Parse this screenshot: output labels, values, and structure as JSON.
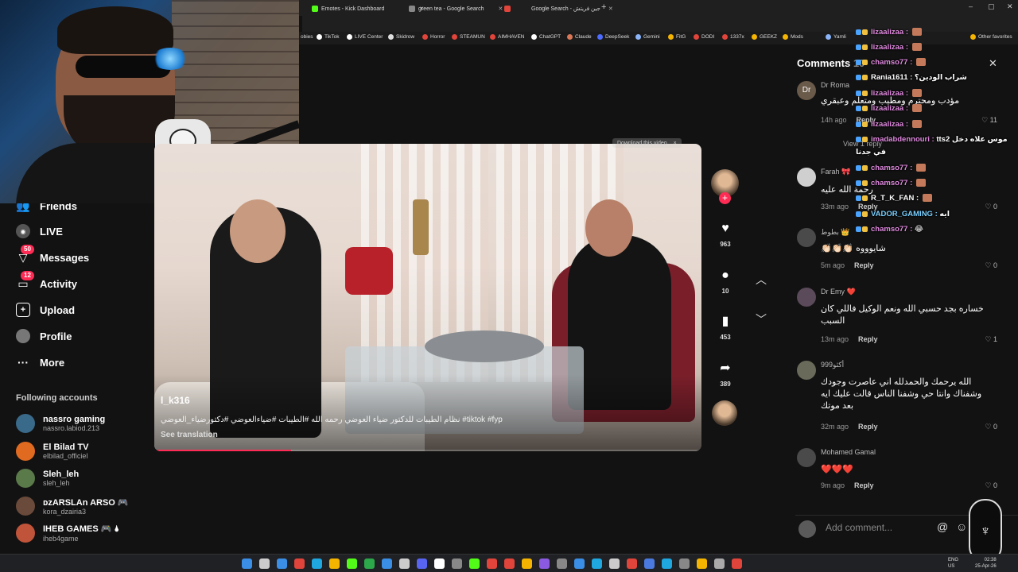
{
  "browser": {
    "tabs": [
      {
        "title": "Emotes - Kick Dashboard",
        "color": "#53fc18"
      },
      {
        "title": "green tea - Google Search",
        "color": "#888888"
      },
      {
        "title": "",
        "color": "#e0443a"
      },
      {
        "title": "Google Search - جين فريتش",
        "color": "#888888"
      }
    ],
    "new_tab": "+",
    "bookmarks": [
      {
        "label": "obies",
        "color": "#777777"
      },
      {
        "label": "TikTok",
        "color": "#ffffff"
      },
      {
        "label": "LIVE Center",
        "color": "#ffffff"
      },
      {
        "label": "Skidrow",
        "color": "#ffffff"
      },
      {
        "label": "Horror",
        "color": "#e0443a"
      },
      {
        "label": "STEAMUN",
        "color": "#e0443a"
      },
      {
        "label": "AIMHAVEN",
        "color": "#e0443a"
      },
      {
        "label": "ChatGPT",
        "color": "#ffffff"
      },
      {
        "label": "Claude",
        "color": "#d97757"
      },
      {
        "label": "DeepSeek",
        "color": "#4d6bfe"
      },
      {
        "label": "Gemini",
        "color": "#8ab4f8"
      },
      {
        "label": "FitG",
        "color": "#f4b400"
      },
      {
        "label": "DODI",
        "color": "#e0443a"
      },
      {
        "label": "1337x",
        "color": "#e0443a"
      },
      {
        "label": "GEEKZ",
        "color": "#f4b400"
      },
      {
        "label": "Mods",
        "color": "#f4b400"
      },
      {
        "label": "Yamli",
        "color": "#8ab4f8"
      },
      {
        "label": "Other favorites",
        "color": "#f4b400"
      }
    ]
  },
  "nav": {
    "items": [
      {
        "label": "Friends",
        "icon": "friends-icon",
        "badge": ""
      },
      {
        "label": "LIVE",
        "icon": "live-icon",
        "badge": ""
      },
      {
        "label": "Messages",
        "icon": "messages-icon",
        "badge": "50"
      },
      {
        "label": "Activity",
        "icon": "activity-icon",
        "badge": "12"
      },
      {
        "label": "Upload",
        "icon": "upload-icon",
        "badge": ""
      },
      {
        "label": "Profile",
        "icon": "profile-icon",
        "badge": ""
      },
      {
        "label": "More",
        "icon": "more-icon",
        "badge": ""
      }
    ],
    "following_title": "Following accounts",
    "accounts": [
      {
        "name": "nassro gaming",
        "handle": "nassro.labiod.213",
        "color": "#3a6a8a"
      },
      {
        "name": "El Bilad TV",
        "handle": "elbilad_officiel",
        "color": "#e06a20"
      },
      {
        "name": "Sleh_leh",
        "handle": "sleh_leh",
        "color": "#5a7a4a"
      },
      {
        "name": "ᴅᴢARSLAn ARSO 🎮",
        "handle": "kora_dzairia3",
        "color": "#6a4a3a"
      },
      {
        "name": "IHEB GAMES 🎮 🌢",
        "handle": "iheb4game",
        "color": "#c0543a"
      }
    ]
  },
  "video": {
    "username": "l_k316",
    "caption": "نظام الطيبات للدكتور ضياء العوضي رحمه الله #الطيبات #ضياءالعوضي #دكتورضياء_العوضي #tiktok #fyp",
    "see_translation": "See translation",
    "progress": 0.25,
    "download_label": "Download this video",
    "download_close": "×",
    "likes": "963",
    "comments": "10",
    "saves": "453",
    "shares": "389",
    "follow_plus": "+"
  },
  "comments_panel": {
    "title": "Comments",
    "count": "10",
    "close": "✕",
    "view_reply": "View 1 reply",
    "add_placeholder": "Add comment...",
    "comments": [
      {
        "user": "Dr Roma",
        "text": "مؤدب ومحترم ومطيب ومتعلم وعبقري",
        "time": "14h ago",
        "reply": "Reply",
        "likes": "11",
        "avatar_text": "Dr",
        "color": "#6a5a4a"
      },
      {
        "user": "Farah 🎀",
        "text": "رحمة الله عليه",
        "time": "33m ago",
        "reply": "Reply",
        "likes": "0",
        "avatar_text": "",
        "color": "#cfcfcf"
      },
      {
        "user": "بطوط 👑",
        "text": "شايوووه 👏🏻👏🏻👏🏻",
        "time": "5m ago",
        "reply": "Reply",
        "likes": "0",
        "avatar_text": "",
        "color": "#4a4a4a"
      },
      {
        "user": "Dr Emy ❤️",
        "text": "خساره بجد حسبي الله ونعم الوكيل فاللي كان السبب",
        "time": "13m ago",
        "reply": "Reply",
        "likes": "1",
        "avatar_text": "",
        "color": "#5a4a5a"
      },
      {
        "user": "999أكثو",
        "text": "الله يرحمك والحمدلله اني عاصرت وجودك وشفناك وانتا حي وشفنا الناس قالت عليك ايه بعد موتك",
        "time": "32m ago",
        "reply": "Reply",
        "likes": "0",
        "avatar_text": "",
        "color": "#6a6a5a"
      },
      {
        "user": "Mohamed Gamal",
        "text": "❤️❤️❤️",
        "time": "9m ago",
        "reply": "Reply",
        "likes": "0",
        "avatar_text": "",
        "color": "#4a4a4a"
      }
    ]
  },
  "stream_chat": [
    {
      "user": "lizaalizaa",
      "color": "#e08adf",
      "msg": ""
    },
    {
      "user": "lizaalizaa",
      "color": "#e08adf",
      "msg": ""
    },
    {
      "user": "chamso77",
      "color": "#e08adf",
      "msg": ""
    },
    {
      "user": "Rania1611",
      "color": "#ffffff",
      "msg": "شراب الودين؟"
    },
    {
      "user": "lizaalizaa",
      "color": "#e08adf",
      "msg": ""
    },
    {
      "user": "lizaalizaa",
      "color": "#e08adf",
      "msg": ""
    },
    {
      "user": "lizaalizaa",
      "color": "#e08adf",
      "msg": ""
    },
    {
      "user": "imadabdennouri",
      "color": "#e08adf",
      "msg": "tts2 موس علاه دخل"
    },
    {
      "user": "",
      "color": "#ffffff",
      "msg": "في جدنا"
    },
    {
      "user": "chamso77",
      "color": "#e08adf",
      "msg": ""
    },
    {
      "user": "chamso77",
      "color": "#e08adf",
      "msg": ""
    },
    {
      "user": "R_T_K_FAN",
      "color": "#ffffff",
      "msg": ""
    },
    {
      "user": "VADOR_GAMING",
      "color": "#7ad0ff",
      "msg": "ايه"
    },
    {
      "user": "chamso77",
      "color": "#e08adf",
      "msg": "😂"
    }
  ],
  "taskbar": {
    "lang": "ENG",
    "region": "US",
    "time": "02:38",
    "date": "25-Apr-26"
  }
}
